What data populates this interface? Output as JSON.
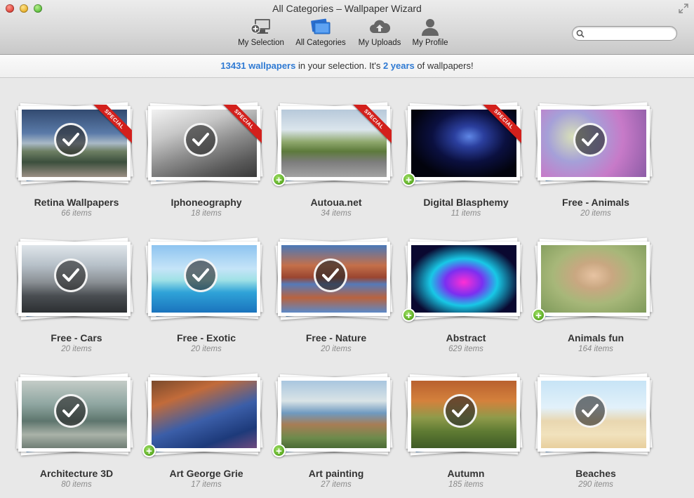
{
  "window": {
    "title": "All Categories – Wallpaper Wizard"
  },
  "toolbar": {
    "items": [
      {
        "label": "My Selection",
        "icon": "monitor-plus-icon"
      },
      {
        "label": "All Categories",
        "icon": "photos-icon",
        "active": true
      },
      {
        "label": "My Uploads",
        "icon": "cloud-upload-icon"
      },
      {
        "label": "My Profile",
        "icon": "person-icon"
      }
    ]
  },
  "search": {
    "value": "",
    "placeholder": ""
  },
  "info": {
    "count": "13431 wallpapers",
    "middle": " in your selection. It's ",
    "duration": "2 years",
    "end": " of wallpapers!"
  },
  "categories": [
    {
      "name": "Retina Wallpapers",
      "count": "66 items",
      "state": "selected",
      "special": true,
      "photo": "lakebridge"
    },
    {
      "name": "Iphoneography",
      "count": "18 items",
      "state": "selected",
      "special": true,
      "photo": "bwbridge"
    },
    {
      "name": "Autoua.net",
      "count": "34 items",
      "state": "add",
      "special": true,
      "photo": "car"
    },
    {
      "name": "Digital Blasphemy",
      "count": "11 items",
      "state": "add",
      "special": true,
      "photo": "space"
    },
    {
      "name": "Free - Animals",
      "count": "20 items",
      "state": "selected",
      "special": false,
      "photo": "hummingbird"
    },
    {
      "name": "Free - Cars",
      "count": "20 items",
      "state": "selected",
      "special": false,
      "photo": "road"
    },
    {
      "name": "Free - Exotic",
      "count": "20 items",
      "state": "selected",
      "special": false,
      "photo": "pool"
    },
    {
      "name": "Free - Nature",
      "count": "20 items",
      "state": "selected",
      "special": false,
      "photo": "canyon"
    },
    {
      "name": "Abstract",
      "count": "629 items",
      "state": "add",
      "special": false,
      "photo": "abstract"
    },
    {
      "name": "Animals fun",
      "count": "164 items",
      "state": "add",
      "special": false,
      "photo": "dog"
    },
    {
      "name": "Architecture 3D",
      "count": "80 items",
      "state": "selected",
      "special": false,
      "photo": "interior"
    },
    {
      "name": "Art George Grie",
      "count": "17 items",
      "state": "add",
      "special": false,
      "photo": "chess"
    },
    {
      "name": "Art painting",
      "count": "27 items",
      "state": "add",
      "special": false,
      "photo": "village"
    },
    {
      "name": "Autumn",
      "count": "185 items",
      "state": "selected",
      "special": false,
      "photo": "autumn"
    },
    {
      "name": "Beaches",
      "count": "290 items",
      "state": "selected",
      "special": false,
      "photo": "beach"
    }
  ],
  "special_label": "SPECIAL",
  "bottom_partial_text": "- ... ... ..."
}
